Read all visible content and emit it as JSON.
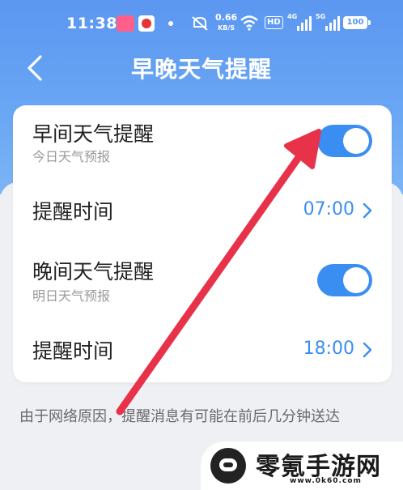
{
  "status_bar": {
    "time": "11:38",
    "net_speed": "0.66",
    "net_speed_unit": "KB/S",
    "hd_label": "HD",
    "signal1_label": "4G",
    "signal2_label": "5G",
    "battery": "100"
  },
  "nav": {
    "title": "早晚天气提醒"
  },
  "settings": {
    "morning": {
      "title": "早间天气提醒",
      "subtitle": "今日天气预报",
      "enabled": true
    },
    "morning_time": {
      "label": "提醒时间",
      "value": "07:00"
    },
    "evening": {
      "title": "晚间天气提醒",
      "subtitle": "明日天气预报",
      "enabled": true
    },
    "evening_time": {
      "label": "提醒时间",
      "value": "18:00"
    }
  },
  "notice": "由于网络原因，提醒消息有可能在前后几分钟送达",
  "watermark": {
    "brand": "零氪手游网",
    "url": "www.0k60.com"
  },
  "colors": {
    "accent": "#3a8ef2",
    "header": "#5b97f0",
    "annotation_arrow": "#e8324a"
  }
}
